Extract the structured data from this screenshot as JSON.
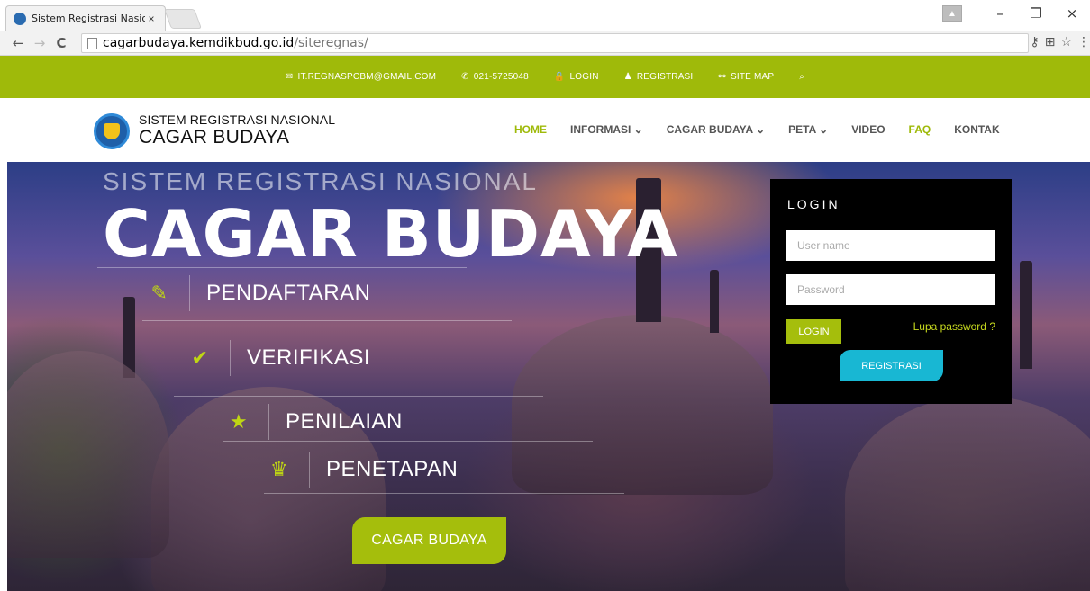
{
  "browser": {
    "tab_title": "Sistem Registrasi Nasional",
    "tab_close": "×",
    "url_host": "cagarbudaya.kemdikbud.go.id",
    "url_path": "/siteregnas/",
    "back": "←",
    "forward": "→",
    "reload": "C",
    "minimize": "–",
    "restore": "❐",
    "close": "×"
  },
  "topbar": {
    "email": "IT.REGNASPCBM@GMAIL.COM",
    "phone": "021-5725048",
    "login": "LOGIN",
    "registrasi": "REGISTRASI",
    "sitemap": "SITE MAP",
    "icons": {
      "email": "envelope-icon",
      "phone": "phone-icon",
      "login": "lock-icon",
      "registrasi": "user-icon",
      "sitemap": "sitemap-icon",
      "search": "search-icon"
    }
  },
  "header": {
    "brand_line1": "SISTEM REGISTRASI NASIONAL",
    "brand_line2": "CAGAR BUDAYA",
    "nav": [
      {
        "label": "HOME"
      },
      {
        "label": "INFORMASI ⌄"
      },
      {
        "label": "CAGAR BUDAYA ⌄"
      },
      {
        "label": "PETA ⌄"
      },
      {
        "label": "VIDEO"
      },
      {
        "label": "FAQ"
      },
      {
        "label": "KONTAK"
      }
    ]
  },
  "hero": {
    "subtitle": "SISTEM REGISTRASI NASIONAL",
    "title": "CAGAR BUDAYA",
    "steps": [
      {
        "label": "PENDAFTARAN",
        "icon": "pencil-icon",
        "glyph": "✎"
      },
      {
        "label": "VERIFIKASI",
        "icon": "check-icon",
        "glyph": "✔"
      },
      {
        "label": "PENILAIAN",
        "icon": "star-icon",
        "glyph": "★"
      },
      {
        "label": "PENETAPAN",
        "icon": "trophy-icon",
        "glyph": "♛"
      }
    ],
    "cta_label": "CAGAR BUDAYA"
  },
  "login": {
    "title": "LOGIN",
    "username_placeholder": "User name",
    "password_placeholder": "Password",
    "login_button": "LOGIN",
    "forgot": "Lupa password ?",
    "register_button": "REGISTRASI"
  },
  "colors": {
    "accent": "#9fba0a",
    "cta": "#a5be0c",
    "register": "#18b7d3"
  }
}
